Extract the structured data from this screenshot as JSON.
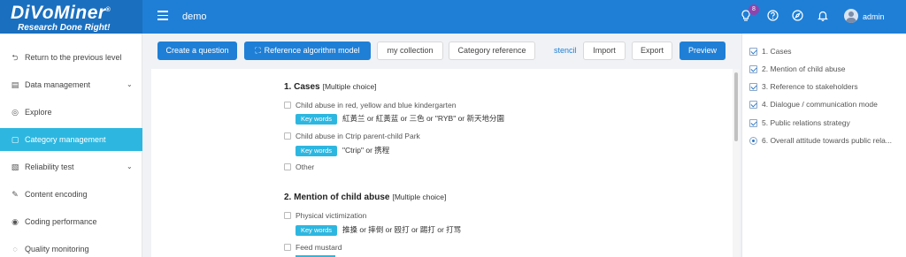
{
  "header": {
    "brand": "DiVoMiner",
    "brand_mark": "®",
    "tagline": "Research Done Right!",
    "project": "demo",
    "notification_count": "8",
    "user": "admin",
    "colors": {
      "topbar": "#1f7fd6",
      "accent": "#2db7e0"
    }
  },
  "sidebar": {
    "items": [
      {
        "label": "Return to the previous level",
        "icon": "return-icon"
      },
      {
        "label": "Data management",
        "icon": "document-icon",
        "expandable": true
      },
      {
        "label": "Explore",
        "icon": "compass-icon"
      },
      {
        "label": "Category management",
        "icon": "category-icon",
        "active": true
      },
      {
        "label": "Reliability test",
        "icon": "reliability-icon",
        "expandable": true
      },
      {
        "label": "Content encoding",
        "icon": "pencil-icon"
      },
      {
        "label": "Coding performance",
        "icon": "performance-icon"
      },
      {
        "label": "Quality monitoring",
        "icon": "eye-icon"
      }
    ]
  },
  "toolbar": {
    "create_question": "Create a question",
    "reference_algorithm": "Reference algorithm model",
    "my_collection": "my collection",
    "category_reference": "Category reference",
    "stencil": "stencil",
    "import": "Import",
    "export": "Export",
    "preview": "Preview"
  },
  "questions": [
    {
      "title": "1. Cases",
      "type": "[Multiple choice]",
      "options": [
        {
          "label": "Child abuse in red, yellow and blue kindergarten",
          "keywords": "紅黃兰 or 紅黃蓝 or 三色 or \"RYB\" or 新天地分園"
        },
        {
          "label": "Child abuse in Ctrip parent-child Park",
          "keywords": "\"Ctrip\" or 携程"
        },
        {
          "label": "Other"
        }
      ]
    },
    {
      "title": "2. Mention of child abuse",
      "type": "[Multiple choice]",
      "options": [
        {
          "label": "Physical victimization",
          "keywords": "推搡 or 摔倒 or 殴打 or 踢打 or 打骂"
        },
        {
          "label": "Feed mustard"
        }
      ]
    }
  ],
  "keyword_tag": "Key words",
  "outline": {
    "items": [
      {
        "label": "1. Cases",
        "kind": "checkbox"
      },
      {
        "label": "2. Mention of child abuse",
        "kind": "checkbox"
      },
      {
        "label": "3. Reference to stakeholders",
        "kind": "checkbox"
      },
      {
        "label": "4. Dialogue / communication mode",
        "kind": "checkbox"
      },
      {
        "label": "5. Public relations strategy",
        "kind": "checkbox"
      },
      {
        "label": "6. Overall attitude towards public rela...",
        "kind": "radio"
      }
    ]
  }
}
